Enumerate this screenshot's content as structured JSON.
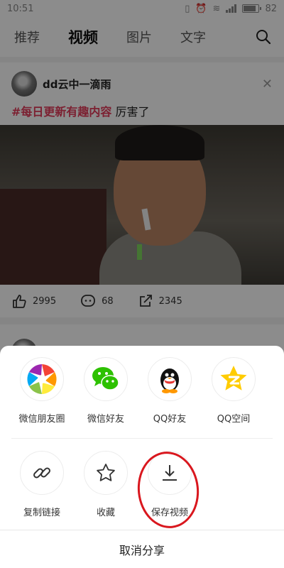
{
  "status": {
    "time": "10:51",
    "battery": "82",
    "battery_level": 0.82
  },
  "nav": {
    "tabs": [
      {
        "label": "推荐"
      },
      {
        "label": "视频",
        "active": true
      },
      {
        "label": "图片"
      },
      {
        "label": "文字"
      }
    ]
  },
  "post": {
    "author": "dd云中一滴雨",
    "hashtag": "#每日更新有趣内容",
    "text": "厉害了",
    "likes": "2995",
    "comments": "68",
    "shares": "2345"
  },
  "share_sheet": {
    "row1": [
      {
        "label": "微信朋友圈",
        "icon": "moments-icon"
      },
      {
        "label": "微信好友",
        "icon": "wechat-icon"
      },
      {
        "label": "QQ好友",
        "icon": "qq-icon"
      },
      {
        "label": "QQ空间",
        "icon": "qzone-icon"
      }
    ],
    "row2": [
      {
        "label": "复制链接",
        "icon": "link-icon"
      },
      {
        "label": "收藏",
        "icon": "star-icon"
      },
      {
        "label": "保存视频",
        "icon": "download-icon"
      }
    ],
    "cancel": "取消分享"
  },
  "colors": {
    "hashtag": "#e23b5a",
    "wechat": "#2dc100",
    "qzone": "#ffcc00",
    "highlight": "#d9171e"
  }
}
